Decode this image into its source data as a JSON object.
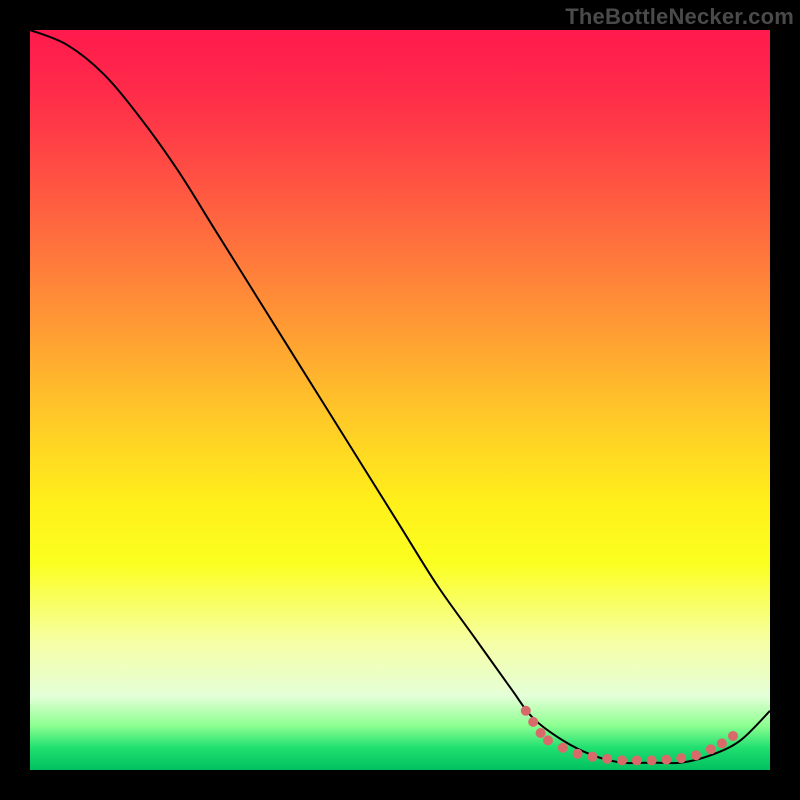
{
  "watermark": "TheBottleNecker.com",
  "chart_data": {
    "type": "line",
    "title": "",
    "xlabel": "",
    "ylabel": "",
    "xlim": [
      0,
      100
    ],
    "ylim": [
      0,
      100
    ],
    "grid": false,
    "legend": false,
    "series": [
      {
        "name": "bottleneck-curve",
        "x": [
          0,
          5,
          10,
          15,
          20,
          25,
          30,
          35,
          40,
          45,
          50,
          55,
          60,
          65,
          68,
          72,
          76,
          80,
          84,
          88,
          92,
          96,
          100
        ],
        "y": [
          100,
          98,
          94,
          88,
          81,
          73,
          65,
          57,
          49,
          41,
          33,
          25,
          18,
          11,
          7,
          4,
          2,
          1,
          1,
          1,
          2,
          4,
          8
        ],
        "stroke": "#000000",
        "stroke_width": 2
      }
    ],
    "markers": [
      {
        "name": "threshold-dots",
        "color": "#d86a6a",
        "radius": 5,
        "points": [
          {
            "x": 67,
            "y": 8
          },
          {
            "x": 68,
            "y": 6.5
          },
          {
            "x": 69,
            "y": 5
          },
          {
            "x": 70,
            "y": 4
          },
          {
            "x": 72,
            "y": 3
          },
          {
            "x": 74,
            "y": 2.2
          },
          {
            "x": 76,
            "y": 1.8
          },
          {
            "x": 78,
            "y": 1.5
          },
          {
            "x": 80,
            "y": 1.3
          },
          {
            "x": 82,
            "y": 1.3
          },
          {
            "x": 84,
            "y": 1.3
          },
          {
            "x": 86,
            "y": 1.4
          },
          {
            "x": 88,
            "y": 1.6
          },
          {
            "x": 90,
            "y": 2.0
          },
          {
            "x": 92,
            "y": 2.8
          },
          {
            "x": 93.5,
            "y": 3.6
          },
          {
            "x": 95,
            "y": 4.6
          }
        ]
      }
    ],
    "background_gradient": {
      "top": "#ff1a4d",
      "mid": "#fff01a",
      "bottom": "#00c060"
    }
  }
}
